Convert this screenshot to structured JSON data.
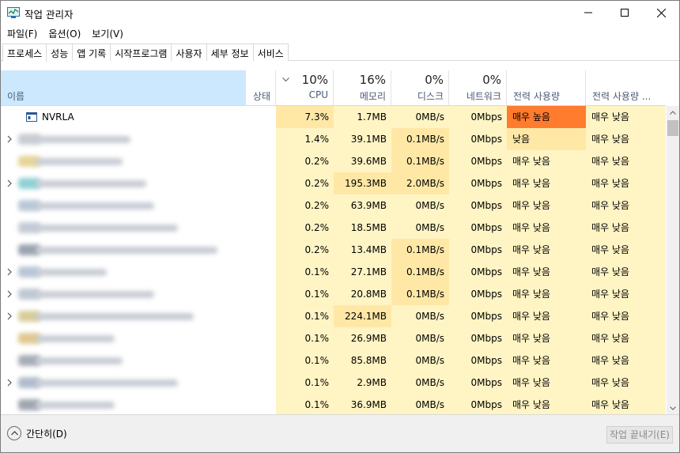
{
  "window": {
    "title": "작업 관리자"
  },
  "menu": [
    "파일(F)",
    "옵션(O)",
    "보기(V)"
  ],
  "tabs": [
    "프로세스",
    "성능",
    "앱 기록",
    "시작프로그램",
    "사용자",
    "세부 정보",
    "서비스"
  ],
  "active_tab": "프로세스",
  "header": {
    "name": "이름",
    "status": "상태",
    "cpu_pct": "10%",
    "cpu": "CPU",
    "mem_pct": "16%",
    "mem": "메모리",
    "disk_pct": "0%",
    "disk": "디스크",
    "net_pct": "0%",
    "net": "네트워크",
    "power": "전력 사용량",
    "power_trend": "전력 사용량 ..."
  },
  "rows": [
    {
      "name": "NVRLA",
      "expandable": false,
      "cpu": "7.3%",
      "mem": "1.7MB",
      "disk": "0MB/s",
      "net": "0Mbps",
      "power": "매우 높음",
      "trend": "매우 낮음"
    },
    {
      "name": "",
      "expandable": true,
      "cpu": "1.4%",
      "mem": "39.1MB",
      "disk": "0.1MB/s",
      "net": "0Mbps",
      "power": "낮음",
      "trend": "매우 낮음"
    },
    {
      "name": "",
      "expandable": false,
      "cpu": "0.2%",
      "mem": "39.6MB",
      "disk": "0.1MB/s",
      "net": "0Mbps",
      "power": "매우 낮음",
      "trend": "매우 낮음"
    },
    {
      "name": "",
      "expandable": true,
      "cpu": "0.2%",
      "mem": "195.3MB",
      "disk": "2.0MB/s",
      "net": "0Mbps",
      "power": "매우 낮음",
      "trend": "매우 낮음"
    },
    {
      "name": "",
      "expandable": false,
      "cpu": "0.2%",
      "mem": "63.9MB",
      "disk": "0MB/s",
      "net": "0Mbps",
      "power": "매우 낮음",
      "trend": "매우 낮음"
    },
    {
      "name": "",
      "expandable": false,
      "cpu": "0.2%",
      "mem": "18.5MB",
      "disk": "0MB/s",
      "net": "0Mbps",
      "power": "매우 낮음",
      "trend": "매우 낮음"
    },
    {
      "name": "",
      "expandable": false,
      "cpu": "0.2%",
      "mem": "13.4MB",
      "disk": "0.1MB/s",
      "net": "0Mbps",
      "power": "매우 낮음",
      "trend": "매우 낮음"
    },
    {
      "name": "",
      "expandable": true,
      "cpu": "0.1%",
      "mem": "27.1MB",
      "disk": "0.1MB/s",
      "net": "0Mbps",
      "power": "매우 낮음",
      "trend": "매우 낮음"
    },
    {
      "name": "",
      "expandable": true,
      "cpu": "0.1%",
      "mem": "20.8MB",
      "disk": "0.1MB/s",
      "net": "0Mbps",
      "power": "매우 낮음",
      "trend": "매우 낮음"
    },
    {
      "name": "",
      "expandable": true,
      "cpu": "0.1%",
      "mem": "224.1MB",
      "disk": "0MB/s",
      "net": "0Mbps",
      "power": "매우 낮음",
      "trend": "매우 낮음"
    },
    {
      "name": "",
      "expandable": false,
      "cpu": "0.1%",
      "mem": "26.9MB",
      "disk": "0MB/s",
      "net": "0Mbps",
      "power": "매우 낮음",
      "trend": "매우 낮음"
    },
    {
      "name": "",
      "expandable": false,
      "cpu": "0.1%",
      "mem": "85.8MB",
      "disk": "0MB/s",
      "net": "0Mbps",
      "power": "매우 낮음",
      "trend": "매우 낮음"
    },
    {
      "name": "",
      "expandable": true,
      "cpu": "0.1%",
      "mem": "2.9MB",
      "disk": "0MB/s",
      "net": "0Mbps",
      "power": "매우 낮음",
      "trend": "매우 낮음"
    },
    {
      "name": "",
      "expandable": false,
      "cpu": "0.1%",
      "mem": "36.9MB",
      "disk": "0MB/s",
      "net": "0Mbps",
      "power": "매우 낮음",
      "trend": "매우 낮음"
    }
  ],
  "footer": {
    "collapse": "간단히(D)",
    "end_task": "작업 끝내기(E)"
  },
  "colors": {
    "selected_header": "#cce8ff",
    "heat_light": "#fff4c4",
    "heat_mid": "#ffe8a6",
    "heat_hot": "#ff7b2e"
  }
}
